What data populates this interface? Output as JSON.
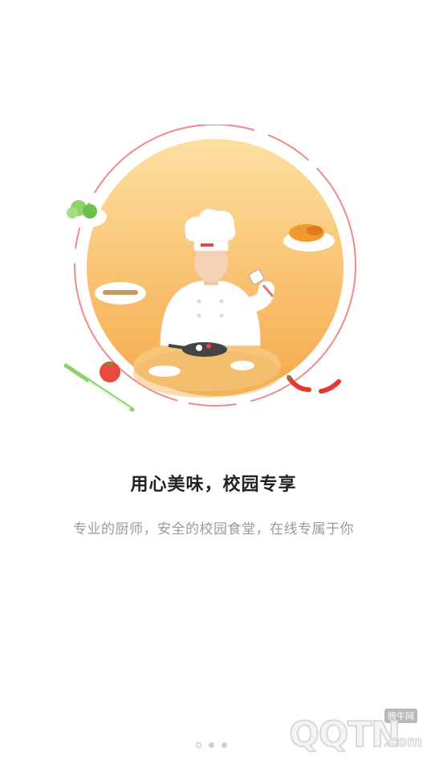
{
  "intro": {
    "title": "用心美味，校园专享",
    "subtitle": "专业的厨师，安全的校园食堂，在线专属于你"
  },
  "pager": {
    "pages": 3,
    "active_index": 0
  },
  "watermark": {
    "text": "QQTN",
    "suffix": ".com",
    "label": "腾牛网"
  },
  "colors": {
    "circle_top": "#fcd98e",
    "circle_bottom": "#f6ad4e",
    "ring": "#f08a8a",
    "title": "#222222",
    "subtitle": "#9a9a9a"
  }
}
